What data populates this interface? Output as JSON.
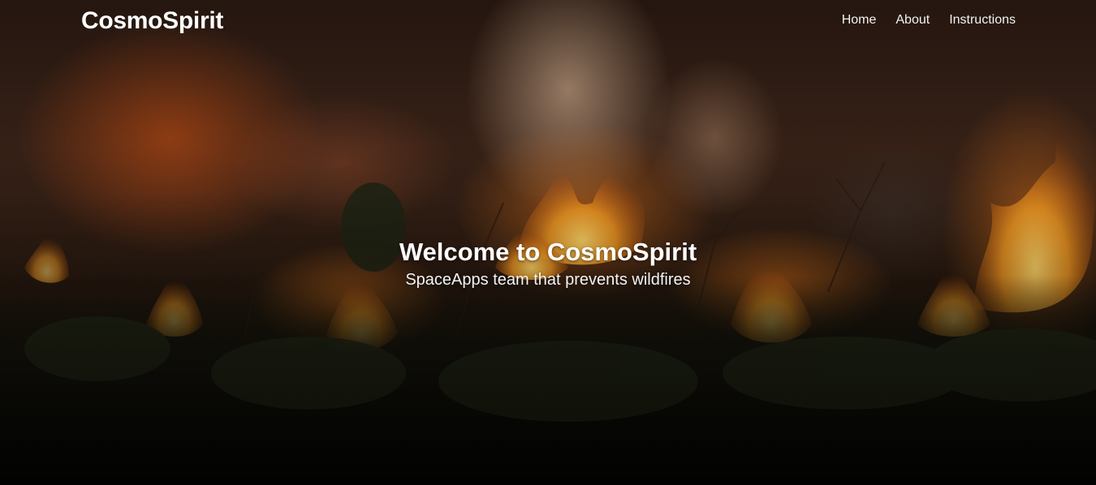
{
  "navbar": {
    "brand": "CosmoSpirit",
    "links": [
      {
        "label": "Home"
      },
      {
        "label": "About"
      },
      {
        "label": "Instructions"
      }
    ]
  },
  "hero": {
    "title": "Welcome to CosmoSpirit",
    "subtitle": "SpaceApps team that prevents wildfires"
  },
  "colors": {
    "text": "#ffffff",
    "fire_orange": "#f08a1c",
    "fire_yellow": "#ffc640",
    "smoke": "#c9a98c"
  }
}
